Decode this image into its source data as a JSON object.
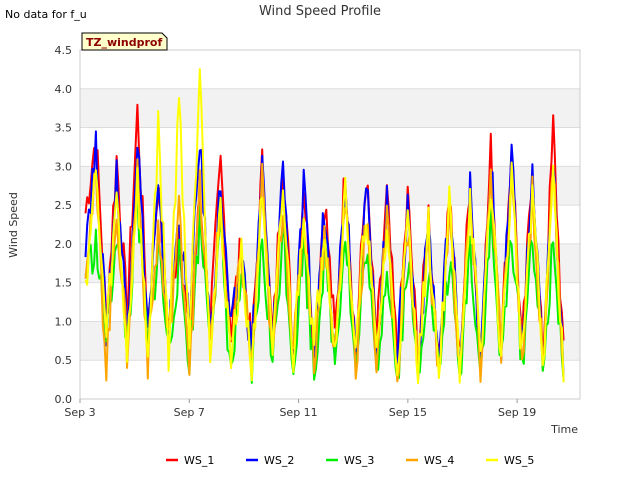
{
  "chart_data": {
    "type": "line",
    "title": "Wind Speed Profile",
    "note": "No data for f_u",
    "badge": "TZ_windprof",
    "xlabel": "Time",
    "ylabel": "Wind Speed",
    "x_start": "Sep 3",
    "x_end": "Sep 21",
    "xlim": [
      3,
      21.3
    ],
    "ylim": [
      0,
      4.5
    ],
    "xticks": [
      {
        "day": 3,
        "label": "Sep 3"
      },
      {
        "day": 7,
        "label": "Sep 7"
      },
      {
        "day": 11,
        "label": "Sep 11"
      },
      {
        "day": 15,
        "label": "Sep 15"
      },
      {
        "day": 19,
        "label": "Sep 19"
      }
    ],
    "yticks": [
      0.0,
      0.5,
      1.0,
      1.5,
      2.0,
      2.5,
      3.0,
      3.5,
      4.0,
      4.5
    ],
    "yticks_labels": [
      "0.0",
      "0.5",
      "1.0",
      "1.5",
      "2.0",
      "2.5",
      "3.0",
      "3.5",
      "4.0",
      "4.5"
    ],
    "grid": true,
    "legend_position": "bottom",
    "series": [
      {
        "name": "WS_1",
        "color": "#ff0000",
        "values": [
          2.4,
          3.4,
          1.0,
          3.1,
          1.1,
          3.7,
          1.0,
          2.8,
          0.9,
          2.2,
          0.8,
          2.6,
          1.0,
          3.0,
          0.9,
          2.0,
          0.6,
          3.0,
          0.7,
          3.2,
          0.5,
          2.8,
          0.7,
          2.6,
          0.8,
          3.0,
          0.6,
          2.9,
          0.7,
          2.6,
          0.5,
          2.6,
          0.5,
          2.4,
          0.4,
          2.7,
          0.5,
          2.8,
          0.5,
          3.2,
          0.7,
          3.3,
          0.6,
          3.0,
          0.5,
          3.5,
          0.5
        ]
      },
      {
        "name": "WS_2",
        "color": "#0000ff",
        "values": [
          2.1,
          3.2,
          0.9,
          2.9,
          1.0,
          3.4,
          0.9,
          2.6,
          0.8,
          2.4,
          0.9,
          3.4,
          0.8,
          2.8,
          0.8,
          1.9,
          0.6,
          3.0,
          0.6,
          3.1,
          0.4,
          2.7,
          0.6,
          2.5,
          0.7,
          2.9,
          0.6,
          2.8,
          0.6,
          2.5,
          0.5,
          2.5,
          0.4,
          2.3,
          0.4,
          2.6,
          0.5,
          2.7,
          0.4,
          3.1,
          0.6,
          3.1,
          0.6,
          2.9,
          0.4,
          3.0,
          0.5
        ]
      },
      {
        "name": "WS_3",
        "color": "#00ee00",
        "values": [
          1.6,
          2.0,
          0.7,
          2.2,
          0.7,
          2.5,
          0.6,
          2.0,
          0.6,
          1.8,
          0.5,
          2.3,
          0.9,
          2.1,
          0.3,
          1.6,
          0.3,
          2.0,
          0.4,
          2.2,
          0.4,
          2.0,
          0.3,
          1.9,
          0.5,
          2.2,
          0.3,
          2.0,
          0.3,
          1.8,
          0.2,
          1.8,
          0.3,
          1.7,
          0.3,
          1.8,
          0.3,
          2.0,
          0.3,
          2.3,
          0.4,
          2.2,
          0.4,
          2.2,
          0.3,
          2.0,
          0.4
        ]
      },
      {
        "name": "WS_4",
        "color": "#ffa500",
        "values": [
          1.8,
          2.8,
          0.4,
          2.5,
          0.6,
          3.0,
          0.5,
          2.2,
          0.7,
          2.4,
          0.5,
          2.7,
          0.7,
          2.5,
          0.5,
          1.9,
          0.4,
          2.8,
          0.4,
          2.6,
          0.5,
          2.4,
          0.5,
          2.2,
          0.6,
          2.6,
          0.4,
          2.4,
          0.5,
          2.3,
          0.3,
          2.2,
          0.4,
          2.1,
          0.3,
          2.4,
          0.4,
          2.5,
          0.4,
          2.9,
          0.6,
          2.8,
          0.5,
          2.7,
          0.4,
          3.0,
          0.4
        ]
      },
      {
        "name": "WS_5",
        "color": "#ffff00",
        "values": [
          1.5,
          2.9,
          0.8,
          2.6,
          0.6,
          2.8,
          0.5,
          3.5,
          0.6,
          3.9,
          0.7,
          4.4,
          0.6,
          2.4,
          0.5,
          1.8,
          0.4,
          2.7,
          0.5,
          2.7,
          0.5,
          2.5,
          0.6,
          2.3,
          0.6,
          2.7,
          0.5,
          2.5,
          0.5,
          2.2,
          0.4,
          2.3,
          0.3,
          2.2,
          0.3,
          2.5,
          0.4,
          2.6,
          0.4,
          2.8,
          0.5,
          2.9,
          0.5,
          2.8,
          0.4,
          2.9,
          0.3
        ]
      }
    ]
  }
}
